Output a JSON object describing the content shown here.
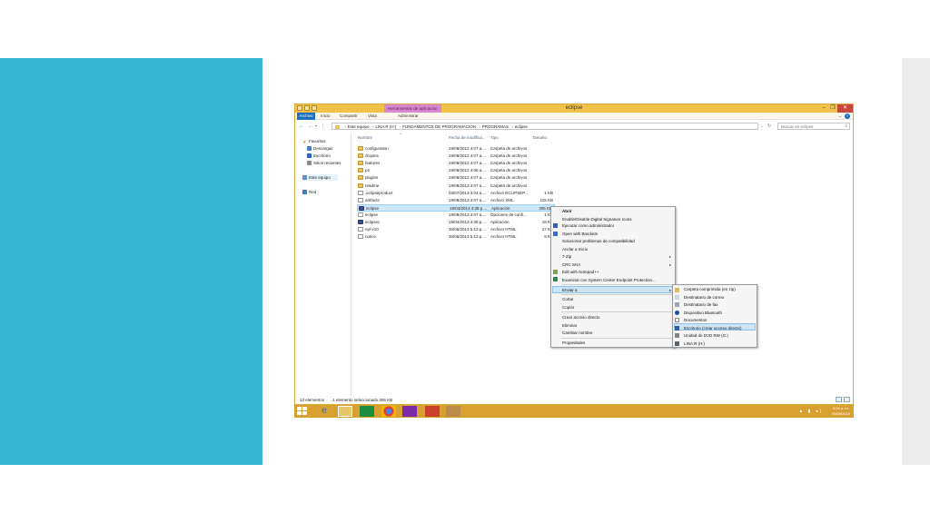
{
  "window": {
    "title": "eclipse",
    "tools_tab": "Herramientas de aplicación",
    "controls": {
      "minimize": "–",
      "maximize": "❐",
      "close": "✕"
    }
  },
  "ribbon": {
    "tabs": [
      "Archivo",
      "Inicio",
      "Compartir",
      "Vista",
      "Administrar"
    ]
  },
  "address": {
    "crumbs": [
      "Este equipo",
      "LINA R (H:)",
      "FUNDAMENTOS DE PROGRAMACION",
      "PROGRAMAS",
      "eclipse"
    ],
    "search_placeholder": "Buscar en eclipse"
  },
  "navpane": {
    "favorites": "Favoritos",
    "downloads": "Descargas",
    "desktop": "Escritorio",
    "recent": "Sitios recientes",
    "this_pc": "Este equipo",
    "network": "Red"
  },
  "columns": {
    "name": "Nombre",
    "date": "Fecha de modifica...",
    "type": "Tipo",
    "size": "Tamaño"
  },
  "files": [
    {
      "name": "configuration",
      "date": "19/09/2013 4:07 a....",
      "type": "Carpeta de archivos",
      "size": "",
      "icon": "folder"
    },
    {
      "name": "dropins",
      "date": "19/09/2013 4:07 a....",
      "type": "Carpeta de archivos",
      "size": "",
      "icon": "folder"
    },
    {
      "name": "features",
      "date": "19/09/2013 4:07 a....",
      "type": "Carpeta de archivos",
      "size": "",
      "icon": "folder"
    },
    {
      "name": "p2",
      "date": "19/09/2013 4:06 a....",
      "type": "Carpeta de archivos",
      "size": "",
      "icon": "folder"
    },
    {
      "name": "plugins",
      "date": "19/09/2013 4:07 a....",
      "type": "Carpeta de archivos",
      "size": "",
      "icon": "folder"
    },
    {
      "name": "readme",
      "date": "19/09/2013 4:07 a....",
      "type": "Carpeta de archivos",
      "size": "",
      "icon": "folder"
    },
    {
      "name": ".eclipseproduct",
      "date": "03/07/2013 3:04 a....",
      "type": "Archivo ECLIPSEP...",
      "size": "1 KB",
      "icon": "file"
    },
    {
      "name": "artifacts",
      "date": "19/09/2013 4:07 a....",
      "type": "Archivo XML",
      "size": "115 KB",
      "icon": "file"
    },
    {
      "name": "eclipse",
      "date": "19/04/2013 4:38 p....",
      "type": "Aplicación",
      "size": "305 KB",
      "icon": "app"
    },
    {
      "name": "eclipse",
      "date": "19/09/2013 4:07 a....",
      "type": "Opciones de confi...",
      "size": "1 KB",
      "icon": "file"
    },
    {
      "name": "eclipsec",
      "date": "19/04/2013 4:38 p....",
      "type": "Aplicación",
      "size": "18 KB",
      "icon": "app"
    },
    {
      "name": "epl-v10",
      "date": "30/06/2013 5:13 p....",
      "type": "Archivo HTML",
      "size": "17 KB",
      "icon": "file"
    },
    {
      "name": "notice",
      "date": "30/06/2013 5:13 p....",
      "type": "Archivo HTML",
      "size": "9 KB",
      "icon": "file"
    }
  ],
  "context_menu": {
    "items": [
      "Abrir",
      "Enable/Disable Digital Signature Icons",
      "Ejecutar como administrador",
      "Open with Brackets",
      "Solucionar problemas de compatibilidad",
      "Anclar a Inicio",
      "7-Zip",
      "CRC SHA",
      "Edit with Notepad++",
      "Examinar con System Center Endpoint Protection...",
      "Enviar a",
      "Cortar",
      "Copiar",
      "Crear acceso directo",
      "Eliminar",
      "Cambiar nombre",
      "Propiedades"
    ]
  },
  "send_to_menu": {
    "items": [
      "Carpeta comprimida (en zip)",
      "Destinatario de correo",
      "Destinatario de fax",
      "Dispositivo Bluetooth",
      "Documentos",
      "Escritorio (crear acceso directo)",
      "Unidad de DVD RW (G:)",
      "LINA R (H:)"
    ]
  },
  "status": {
    "count": "13 elementos",
    "selected": "1 elemento seleccionado  305 KB"
  },
  "taskbar": {
    "time": "8:24 a. m.",
    "date": "05/08/2016",
    "tray": "▲ ▮ ◂)"
  },
  "colors": {
    "teal_panel": "#35b5cf",
    "title_bar": "#f1c24a",
    "taskbar": "#d8a030",
    "file_tab": "#1b6dc0",
    "tools_tab": "#d987d0",
    "selection": "#cce8ff"
  }
}
